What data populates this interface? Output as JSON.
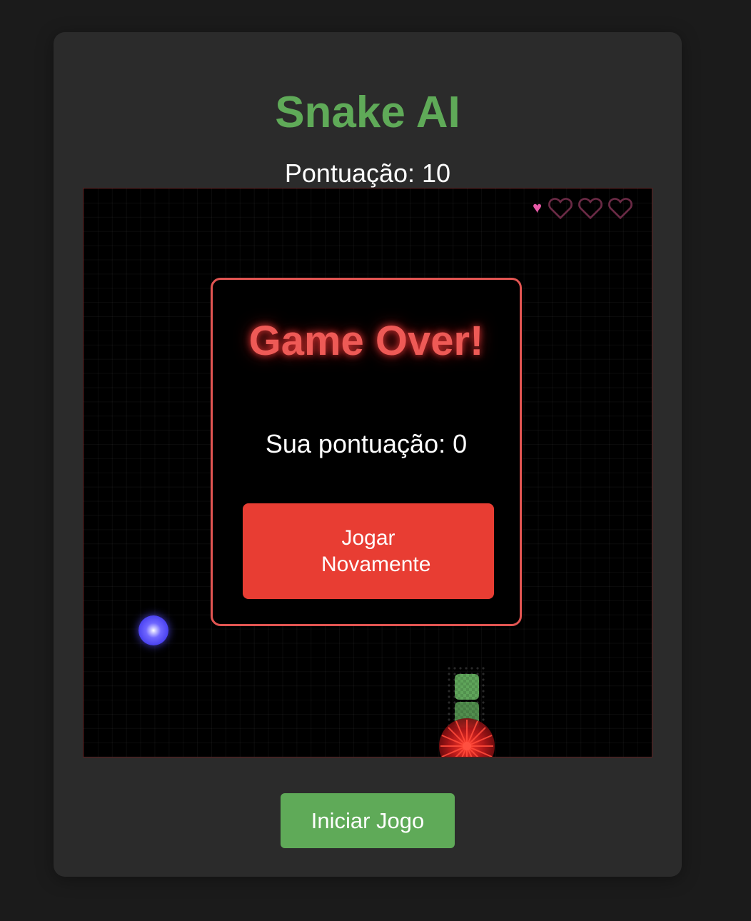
{
  "header": {
    "title": "Snake AI",
    "score_label": "Pontuação: 10"
  },
  "game": {
    "lives_total": 3,
    "lives_remaining": 0,
    "lives_indicator_icon": "heart-icon"
  },
  "game_over": {
    "title": "Game Over!",
    "score_text": "Sua pontuação: 0",
    "retry_label": "Jogar Novamente"
  },
  "controls": {
    "start_label": "Iniciar Jogo"
  },
  "colors": {
    "accent_green": "#5faa58",
    "danger_red": "#e83d33",
    "food_blue": "#4a42f0",
    "life_pink": "#e85aa8"
  }
}
